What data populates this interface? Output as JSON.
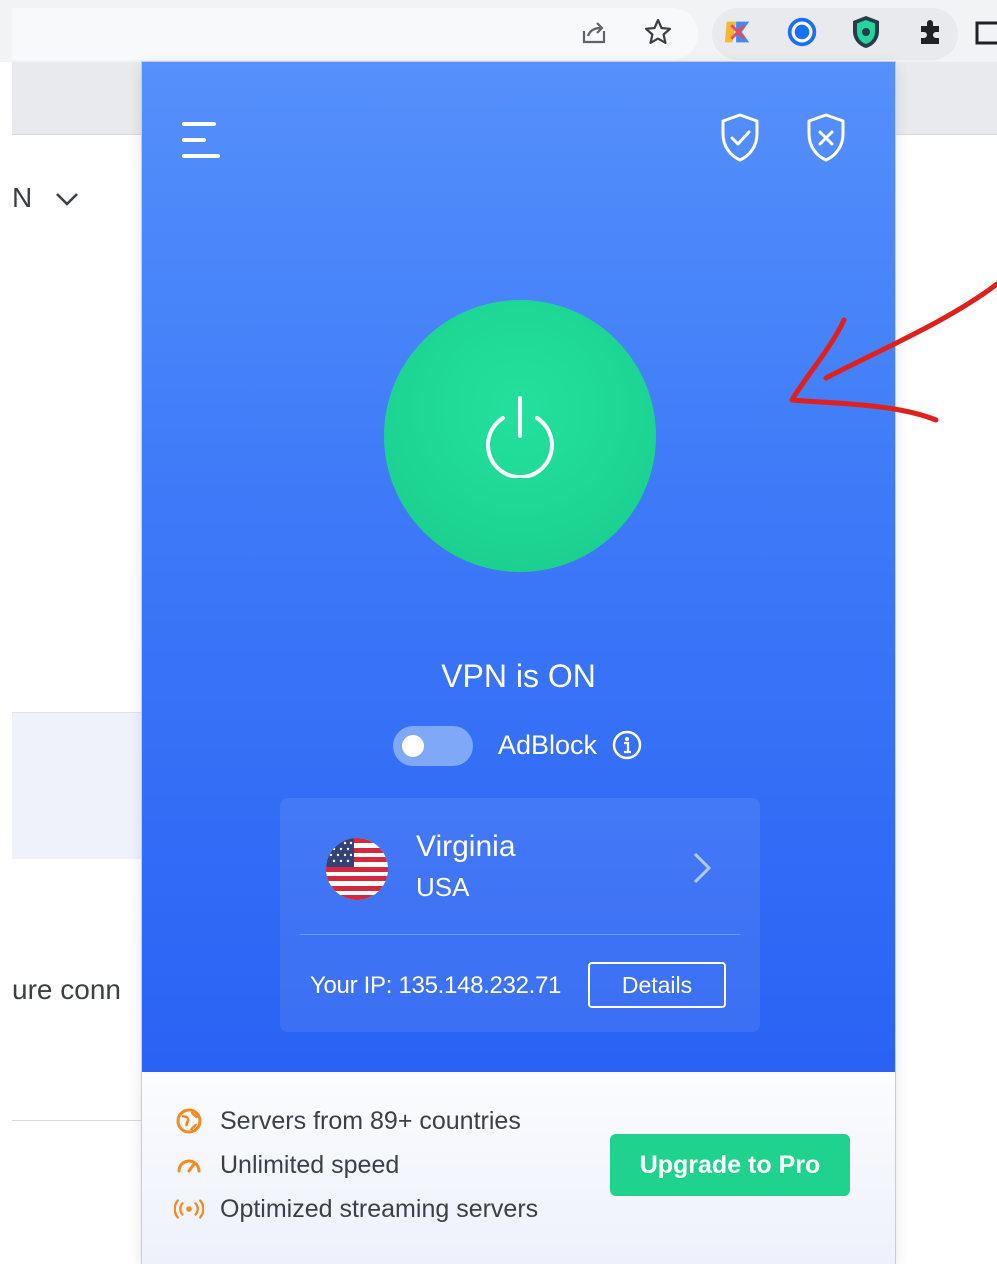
{
  "browser": {
    "toolbar_icons": [
      "share-icon",
      "star-icon"
    ],
    "extensions": [
      "bitwarden-extension-icon",
      "grammarly-extension-icon",
      "vpn-extension-icon",
      "puzzle-extensions-icon"
    ]
  },
  "page_behind": {
    "dropdown_fragment": "N",
    "text_fragment": "ure conn"
  },
  "popup": {
    "status": "VPN is ON",
    "adblock_label": "AdBlock",
    "adblock_enabled": false,
    "location": {
      "city": "Virginia",
      "country": "USA"
    },
    "ip_text": "Your IP: 135.148.232.71",
    "details_label": "Details",
    "features": [
      {
        "icon": "globe-icon",
        "label": "Servers from 89+ countries"
      },
      {
        "icon": "speedometer-icon",
        "label": "Unlimited speed"
      },
      {
        "icon": "streaming-icon",
        "label": "Optimized streaming servers"
      }
    ],
    "upgrade_label": "Upgrade to Pro"
  },
  "colors": {
    "popup_gradient_top": "#5590fb",
    "popup_gradient_bottom": "#2a62f4",
    "power_green": "#1dd593",
    "upgrade_green": "#1fd38f",
    "feature_icon_orange": "#f58a1f",
    "annotation_red": "#e0201b"
  }
}
